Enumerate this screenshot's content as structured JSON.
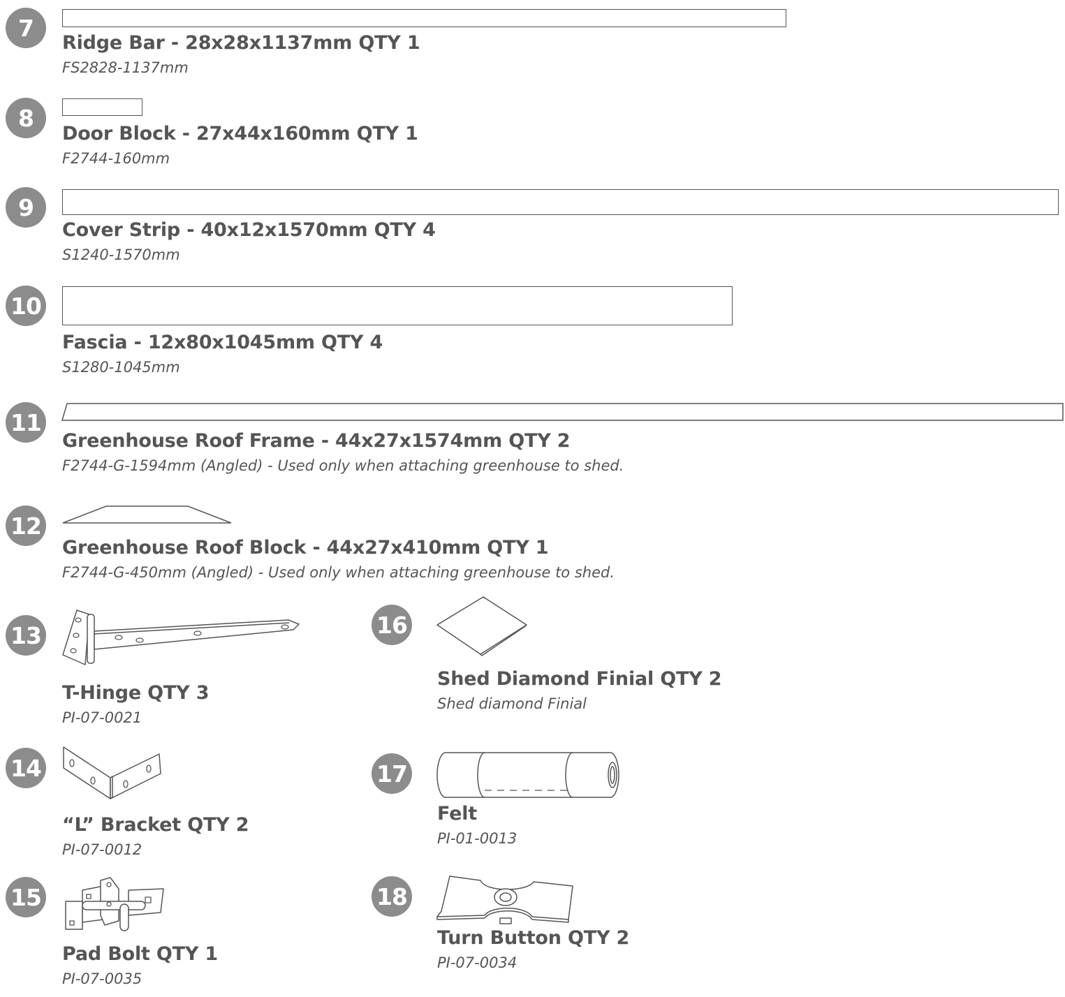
{
  "items": [
    {
      "num": "7",
      "title": "Ridge Bar - 28x28x1137mm QTY 1",
      "code": "FS2828-1137mm"
    },
    {
      "num": "8",
      "title": "Door Block - 27x44x160mm QTY 1",
      "code": "F2744-160mm"
    },
    {
      "num": "9",
      "title": "Cover Strip - 40x12x1570mm QTY 4",
      "code": "S1240-1570mm"
    },
    {
      "num": "10",
      "title": "Fascia - 12x80x1045mm QTY 4",
      "code": "S1280-1045mm"
    },
    {
      "num": "11",
      "title": "Greenhouse Roof Frame - 44x27x1574mm QTY 2",
      "code": "F2744-G-1594mm (Angled) - Used only when attaching greenhouse to shed."
    },
    {
      "num": "12",
      "title": "Greenhouse Roof Block - 44x27x410mm QTY 1",
      "code": "F2744-G-450mm (Angled) - Used only when attaching greenhouse to shed."
    },
    {
      "num": "13",
      "title": "T-Hinge QTY 3",
      "code": "PI-07-0021"
    },
    {
      "num": "14",
      "title": "“L” Bracket QTY 2",
      "code": "PI-07-0012"
    },
    {
      "num": "15",
      "title": "Pad Bolt QTY 1",
      "code": "PI-07-0035"
    },
    {
      "num": "16",
      "title": "Shed Diamond Finial QTY 2",
      "code": "Shed diamond Finial"
    },
    {
      "num": "17",
      "title": "Felt",
      "code": "PI-01-0013"
    },
    {
      "num": "18",
      "title": "Turn Button QTY 2",
      "code": "PI-07-0034"
    }
  ],
  "colors": {
    "badge": "#8c8c8c",
    "text": "#555555",
    "line": "#555555"
  },
  "icons": [
    "t-hinge-icon",
    "l-bracket-icon",
    "pad-bolt-icon",
    "diamond-finial-icon",
    "felt-roll-icon",
    "turn-button-icon"
  ]
}
